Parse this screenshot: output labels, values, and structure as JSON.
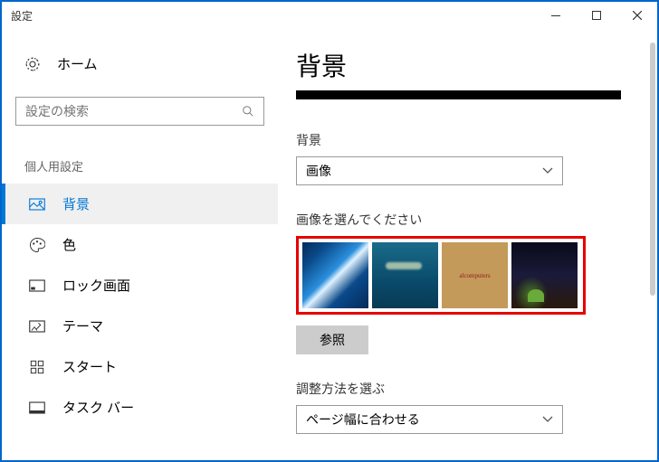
{
  "window": {
    "title": "設定"
  },
  "sidebar": {
    "home": "ホーム",
    "searchPlaceholder": "設定の検索",
    "groupLabel": "個人用設定",
    "items": [
      {
        "label": "背景"
      },
      {
        "label": "色"
      },
      {
        "label": "ロック画面"
      },
      {
        "label": "テーマ"
      },
      {
        "label": "スタート"
      },
      {
        "label": "タスク バー"
      }
    ]
  },
  "main": {
    "title": "背景",
    "bgLabel": "背景",
    "bgValue": "画像",
    "chooseLabel": "画像を選んでください",
    "browse": "参照",
    "fitLabel": "調整方法を選ぶ",
    "fitValue": "ページ幅に合わせる",
    "thumb3text": "alcomputers"
  }
}
